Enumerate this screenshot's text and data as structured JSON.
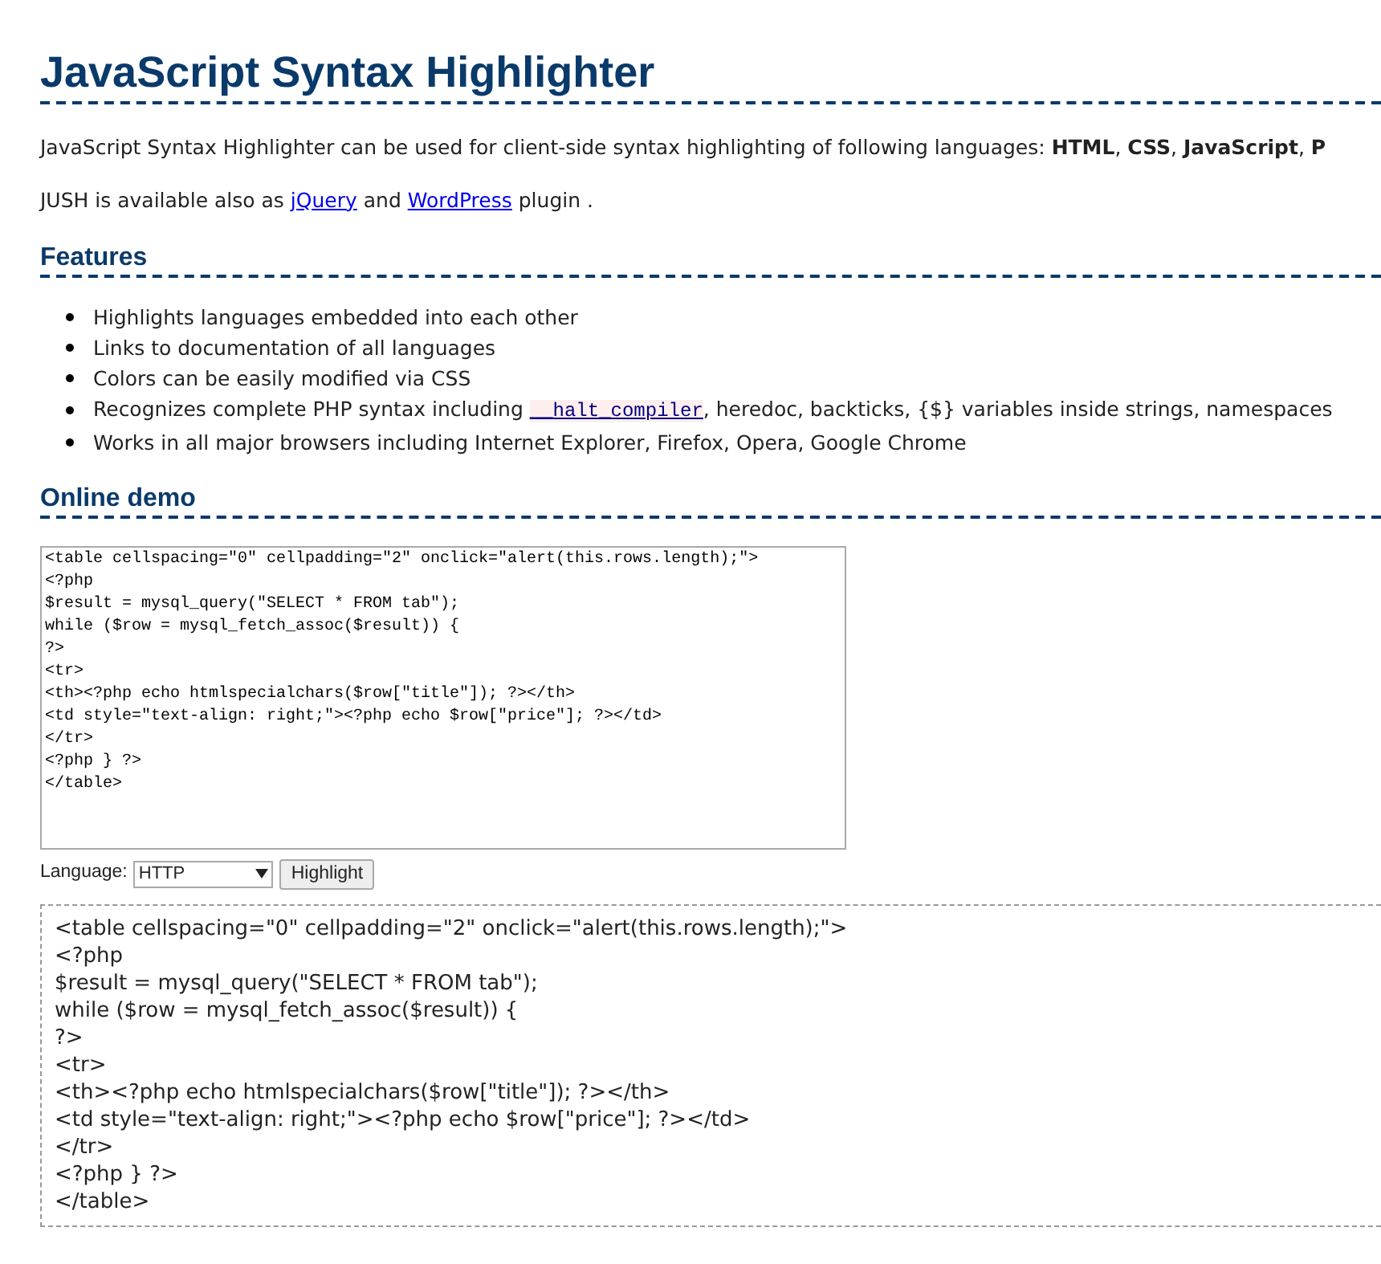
{
  "title": "JavaScript Syntax Highlighter",
  "intro": "JavaScript Syntax Highlighter can be used for client-side syntax highlighting of following languages: **HTML**, **CSS**, **JavaScript**, **P**",
  "availability": [
    {
      "kind": "text",
      "text": "JUSH is available also as "
    },
    {
      "kind": "link",
      "text": "jQuery"
    },
    {
      "kind": "text",
      "text": " and "
    },
    {
      "kind": "link",
      "text": "WordPress"
    },
    {
      "kind": "text",
      "text": " plugin ."
    }
  ],
  "features_heading": "Features",
  "features": [
    [
      {
        "kind": "text",
        "text": "Highlights languages embedded into each other"
      }
    ],
    [
      {
        "kind": "text",
        "text": "Links to documentation of all languages"
      }
    ],
    [
      {
        "kind": "text",
        "text": "Colors can be easily modified via CSS"
      }
    ],
    [
      {
        "kind": "text",
        "text": "Recognizes complete PHP syntax including "
      },
      {
        "kind": "code_link",
        "text": "__halt_compiler"
      },
      {
        "kind": "text",
        "text": ", heredoc, backticks, {$} variables inside strings, namespaces"
      }
    ],
    [
      {
        "kind": "text",
        "text": "Works in all major browsers including Internet Explorer, Firefox, Opera, Google Chrome"
      }
    ]
  ],
  "demo_heading": "Online demo",
  "editor": {
    "lines": [
      "<table cellspacing=\"0\" cellpadding=\"2\" onclick=\"alert(this.rows.length);\">",
      "<?php",
      "$result = mysql_query(\"SELECT * FROM tab\");",
      "while ($row = mysql_fetch_assoc($result)) {",
      "?>",
      "<tr>",
      "<th><?php echo htmlspecialchars($row[\"title\"]); ?></th>",
      "<td style=\"text-align: right;\"><?php echo $row[\"price\"]; ?></td>",
      "</tr>",
      "<?php } ?>",
      "</table>"
    ]
  },
  "language_label": "Language:",
  "language_value": "HTTP",
  "highlight_button": "Highlight",
  "output": {
    "lines": [
      "<table cellspacing=\"0\" cellpadding=\"2\" onclick=\"alert(this.rows.length);\">",
      "<?php",
      "$result = mysql_query(\"SELECT * FROM tab\");",
      "while ($row = mysql_fetch_assoc($result)) {",
      "?>",
      "<tr>",
      "<th><?php echo htmlspecialchars($row[\"title\"]); ?></th>",
      "<td style=\"text-align: right;\"><?php echo $row[\"price\"]; ?></td>",
      "</tr>",
      "<?php } ?>",
      "</table>"
    ]
  }
}
